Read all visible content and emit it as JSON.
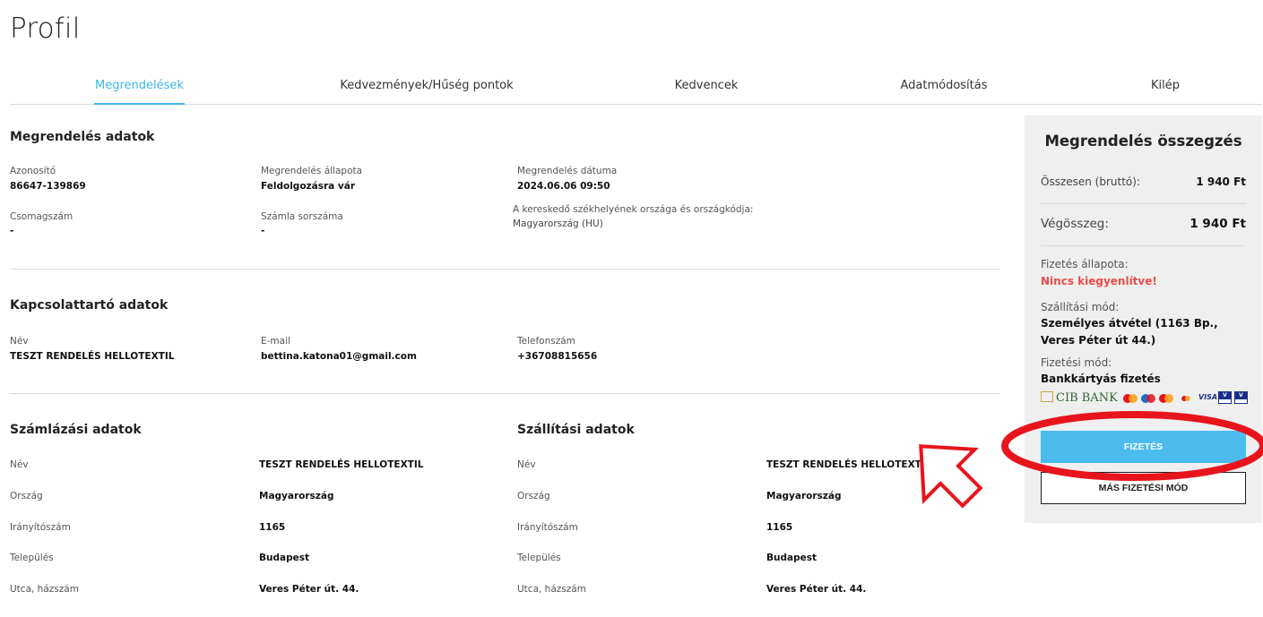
{
  "page": {
    "title": "Profil"
  },
  "tabs": [
    {
      "label": "Megrendelések"
    },
    {
      "label": "Kedvezmények/Hűség pontok"
    },
    {
      "label": "Kedvencek"
    },
    {
      "label": "Adatmódosítás"
    },
    {
      "label": "Kilép"
    }
  ],
  "order": {
    "title": "Megrendelés adatok",
    "id_label": "Azonosító",
    "id_value": "86647-139869",
    "status_label": "Megrendelés állapota",
    "status_value": "Feldolgozásra vár",
    "date_label": "Megrendelés dátuma",
    "date_value": "2024.06.06 09:50",
    "package_label": "Csomagszám",
    "package_value": "-",
    "invoice_label": "Számla sorszáma",
    "invoice_value": "-",
    "merchant_label": "A kereskedő székhelyének országa és országkódja:",
    "merchant_value": "Magyarország (HU)"
  },
  "contact": {
    "title": "Kapcsolattartó adatok",
    "name_label": "Név",
    "name_value": "TESZT RENDELÉS HELLOTEXTIL",
    "email_label": "E-mail",
    "email_value": "bettina.katona01@gmail.com",
    "phone_label": "Telefonszám",
    "phone_value": "+36708815656"
  },
  "billing": {
    "title": "Számlázási adatok",
    "rows": [
      {
        "label": "Név",
        "value": "TESZT RENDELÉS HELLOTEXTIL"
      },
      {
        "label": "Ország",
        "value": "Magyarország"
      },
      {
        "label": "Irányítószám",
        "value": "1165"
      },
      {
        "label": "Település",
        "value": "Budapest"
      },
      {
        "label": "Utca, házszám",
        "value": "Veres Péter út. 44."
      }
    ]
  },
  "shipping": {
    "title": "Szállítási adatok",
    "rows": [
      {
        "label": "Név",
        "value": "TESZT RENDELÉS HELLOTEXTIL"
      },
      {
        "label": "Ország",
        "value": "Magyarország"
      },
      {
        "label": "Irányítószám",
        "value": "1165"
      },
      {
        "label": "Település",
        "value": "Budapest"
      },
      {
        "label": "Utca, házszám",
        "value": "Veres Péter út. 44."
      }
    ]
  },
  "summary": {
    "title": "Megrendelés összegzés",
    "gross_label": "Összesen (bruttó):",
    "gross_value": "1 940 Ft",
    "total_label": "Végösszeg:",
    "total_value": "1 940 Ft",
    "payment_status_label": "Fizetés állapota:",
    "payment_status_value": "Nincs kiegyenlítve!",
    "shipping_method_label": "Szállítási mód:",
    "shipping_method_value": "Személyes átvétel (1163 Bp., Veres Péter út 44.)",
    "payment_method_label": "Fizetési mód:",
    "payment_method_value": "Bankkártyás fizetés",
    "bank_logo": "CIB BANK",
    "visa_logo": "VISA",
    "pay_button": "FIZETÉS",
    "other_button": "MÁS FIZETÉSI MÓD"
  },
  "colors": {
    "accent": "#3fb4e8",
    "pay_button": "#4cbcef",
    "alert": "#f04a4a",
    "annotation": "#e8141c"
  }
}
